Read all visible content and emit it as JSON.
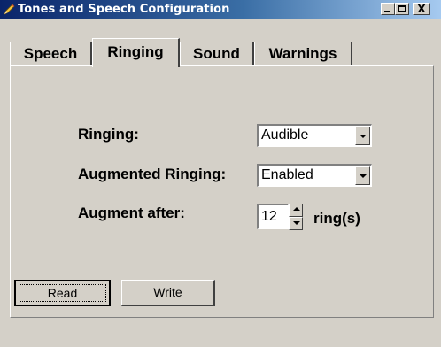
{
  "window": {
    "title": "Tones and Speech Configuration",
    "controls": {
      "minimize": "_",
      "maximize": "□",
      "close": "X"
    }
  },
  "tabs": [
    {
      "label": "Speech",
      "active": false
    },
    {
      "label": "Ringing",
      "active": true
    },
    {
      "label": "Sound",
      "active": false
    },
    {
      "label": "Warnings",
      "active": false
    }
  ],
  "ringing": {
    "ringing_label": "Ringing:",
    "ringing_value": "Audible",
    "augmented_label": "Augmented Ringing:",
    "augmented_value": "Enabled",
    "augment_after_label": "Augment after:",
    "augment_after_value": "12",
    "augment_after_unit": "ring(s)"
  },
  "buttons": {
    "read_label": "Read",
    "write_label": "Write"
  },
  "icons": {
    "app": "pencil-icon",
    "dropdown": "chevron-down-icon"
  }
}
